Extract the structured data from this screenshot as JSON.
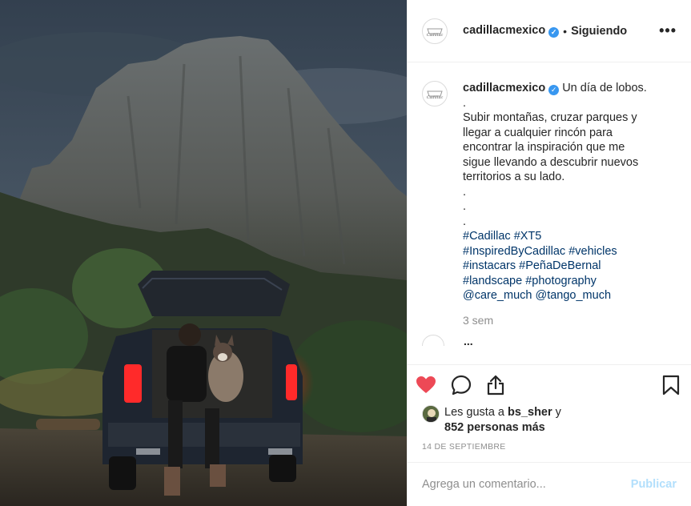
{
  "post": {
    "username": "cadillacmexico",
    "verified_mark": "✓",
    "separator": "•",
    "follow_status": "Siguiendo",
    "more_label": "•••"
  },
  "caption": {
    "username": "cadillacmexico",
    "first_line": "Un día de lobos.",
    "lines": [
      ".",
      "Subir montañas, cruzar parques y",
      "llegar a cualquier rincón para",
      "encontrar la inspiración que me",
      "sigue llevando a descubrir nuevos",
      "territorios a su lado.",
      ".",
      ".",
      "."
    ],
    "tag_lines": [
      [
        "#Cadillac",
        "#XT5"
      ],
      [
        "#InspiredByCadillac",
        "#vehicles"
      ],
      [
        "#instacars",
        "#PeñaDeBernal"
      ],
      [
        "#landscape",
        "#photography"
      ],
      [
        "@care_much",
        "@tango_much"
      ]
    ],
    "time": "3 sem"
  },
  "next_comment_partial": "...",
  "likes": {
    "prefix": "Les gusta a",
    "user": "bs_sher",
    "conj": "y",
    "others": "852 personas más"
  },
  "date": "14 DE SEPTIEMBRE",
  "comment_box": {
    "placeholder": "Agrega un comentario...",
    "publish_label": "Publicar"
  },
  "icons": {
    "like": "heart-icon",
    "comment": "comment-icon",
    "share": "share-icon",
    "save": "bookmark-icon"
  },
  "colors": {
    "like_red": "#ed4956",
    "hashtag": "#003569",
    "verified": "#3897f0",
    "publish_disabled": "#b2dffc"
  }
}
